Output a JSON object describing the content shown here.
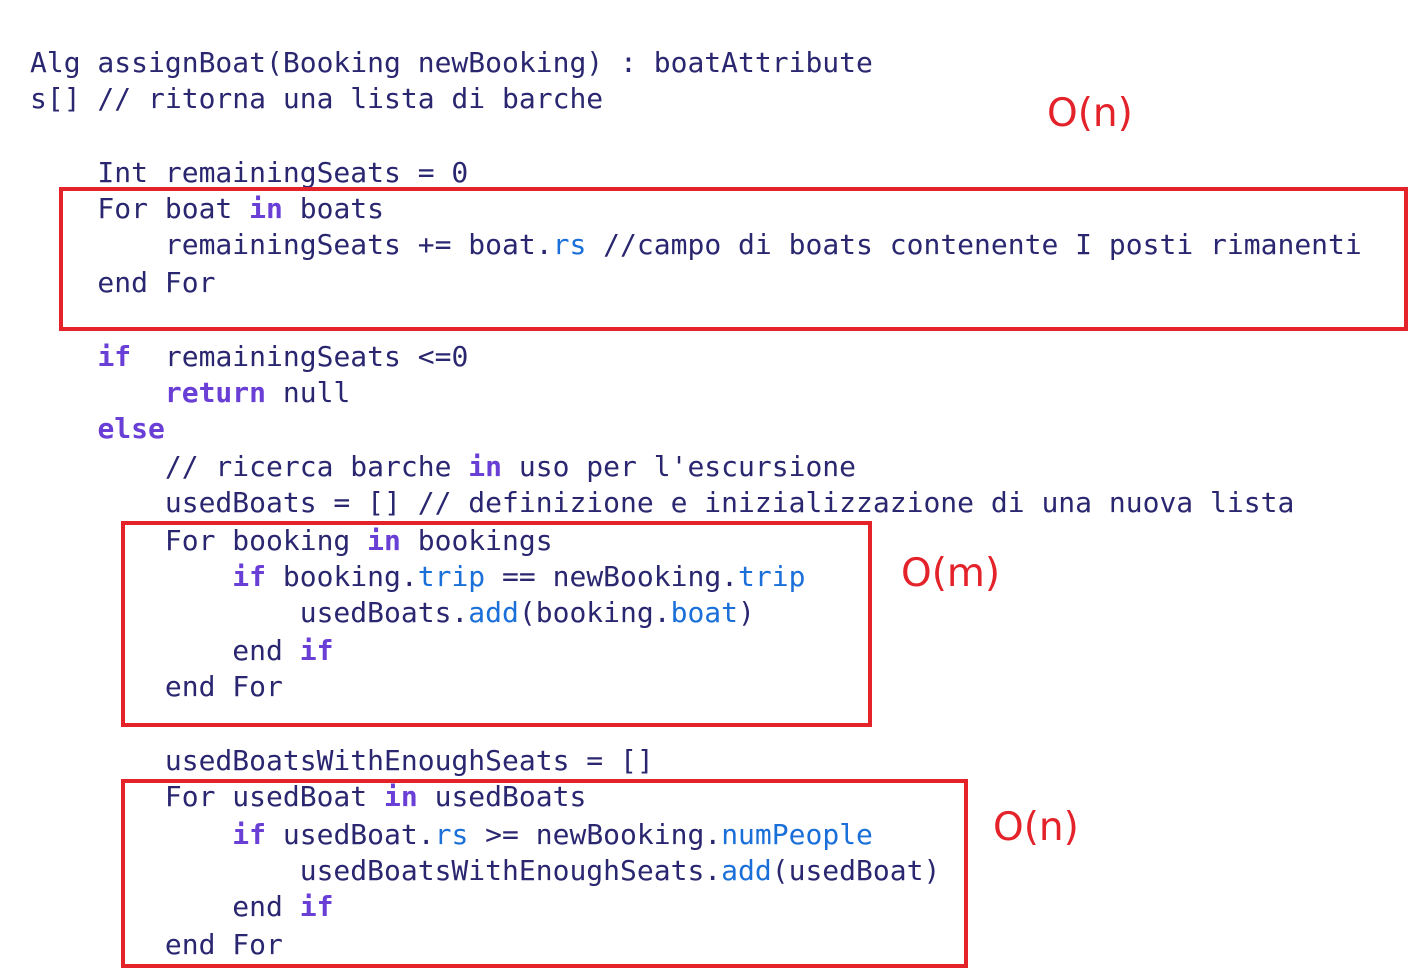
{
  "lines": [
    [
      {
        "t": "Alg assignBoat(Booking newBooking) : boatAttribute",
        "c": "plain"
      }
    ],
    [
      {
        "t": "s[] // ritorna una lista di barche",
        "c": "plain"
      }
    ],
    [
      {
        "t": "    Int remainingSeats = 0",
        "c": "plain"
      }
    ],
    [
      {
        "t": "    For boat ",
        "c": "plain"
      },
      {
        "t": "in",
        "c": "kw"
      },
      {
        "t": " boats",
        "c": "plain"
      }
    ],
    [
      {
        "t": "        remainingSeats += boat.",
        "c": "plain"
      },
      {
        "t": "rs",
        "c": "field"
      },
      {
        "t": " //campo di boats contenente I posti rimanenti",
        "c": "plain"
      }
    ],
    [
      {
        "t": "    end For",
        "c": "plain"
      }
    ],
    [
      {
        "t": "    ",
        "c": "plain"
      },
      {
        "t": "if",
        "c": "kw"
      },
      {
        "t": "  remainingSeats <=0",
        "c": "plain"
      }
    ],
    [
      {
        "t": "        ",
        "c": "plain"
      },
      {
        "t": "return",
        "c": "kw"
      },
      {
        "t": " null",
        "c": "plain"
      }
    ],
    [
      {
        "t": "    ",
        "c": "plain"
      },
      {
        "t": "else",
        "c": "kw"
      }
    ],
    [
      {
        "t": "        // ricerca barche ",
        "c": "plain"
      },
      {
        "t": "in",
        "c": "kw"
      },
      {
        "t": " uso per l'escursione",
        "c": "plain"
      }
    ],
    [
      {
        "t": "        usedBoats = [] // definizione e inizializzazione di una nuova lista",
        "c": "plain"
      }
    ],
    [
      {
        "t": "        For booking ",
        "c": "plain"
      },
      {
        "t": "in",
        "c": "kw"
      },
      {
        "t": " bookings",
        "c": "plain"
      }
    ],
    [
      {
        "t": "            ",
        "c": "plain"
      },
      {
        "t": "if",
        "c": "kw"
      },
      {
        "t": " booking.",
        "c": "plain"
      },
      {
        "t": "trip",
        "c": "field"
      },
      {
        "t": " == newBooking.",
        "c": "plain"
      },
      {
        "t": "trip",
        "c": "field"
      }
    ],
    [
      {
        "t": "                usedBoats.",
        "c": "plain"
      },
      {
        "t": "add",
        "c": "field"
      },
      {
        "t": "(booking.",
        "c": "plain"
      },
      {
        "t": "boat",
        "c": "field"
      },
      {
        "t": ")",
        "c": "plain"
      }
    ],
    [
      {
        "t": "            end ",
        "c": "plain"
      },
      {
        "t": "if",
        "c": "kw"
      }
    ],
    [
      {
        "t": "        end For",
        "c": "plain"
      }
    ],
    [
      {
        "t": "        usedBoatsWithEnoughSeats = []",
        "c": "plain"
      }
    ],
    [
      {
        "t": "        For usedBoat ",
        "c": "plain"
      },
      {
        "t": "in",
        "c": "kw"
      },
      {
        "t": " usedBoats",
        "c": "plain"
      }
    ],
    [
      {
        "t": "            ",
        "c": "plain"
      },
      {
        "t": "if",
        "c": "kw"
      },
      {
        "t": " usedBoat.",
        "c": "plain"
      },
      {
        "t": "rs",
        "c": "field"
      },
      {
        "t": " >= newBooking.",
        "c": "plain"
      },
      {
        "t": "numPeople",
        "c": "field"
      }
    ],
    [
      {
        "t": "                usedBoatsWithEnoughSeats.",
        "c": "plain"
      },
      {
        "t": "add",
        "c": "field"
      },
      {
        "t": "(usedBoat)",
        "c": "plain"
      }
    ],
    [
      {
        "t": "            end ",
        "c": "plain"
      },
      {
        "t": "if",
        "c": "kw"
      }
    ],
    [
      {
        "t": "        end For",
        "c": "plain"
      }
    ]
  ],
  "annotations": {
    "first_loop": "O(n)",
    "bookings_loop": "O(m)",
    "used_boats_loop": "O(n)"
  },
  "colors": {
    "code_text": "#2a2770",
    "keyword": "#6a3fd6",
    "field": "#1b6fd8",
    "annotation": "#e3222a"
  }
}
